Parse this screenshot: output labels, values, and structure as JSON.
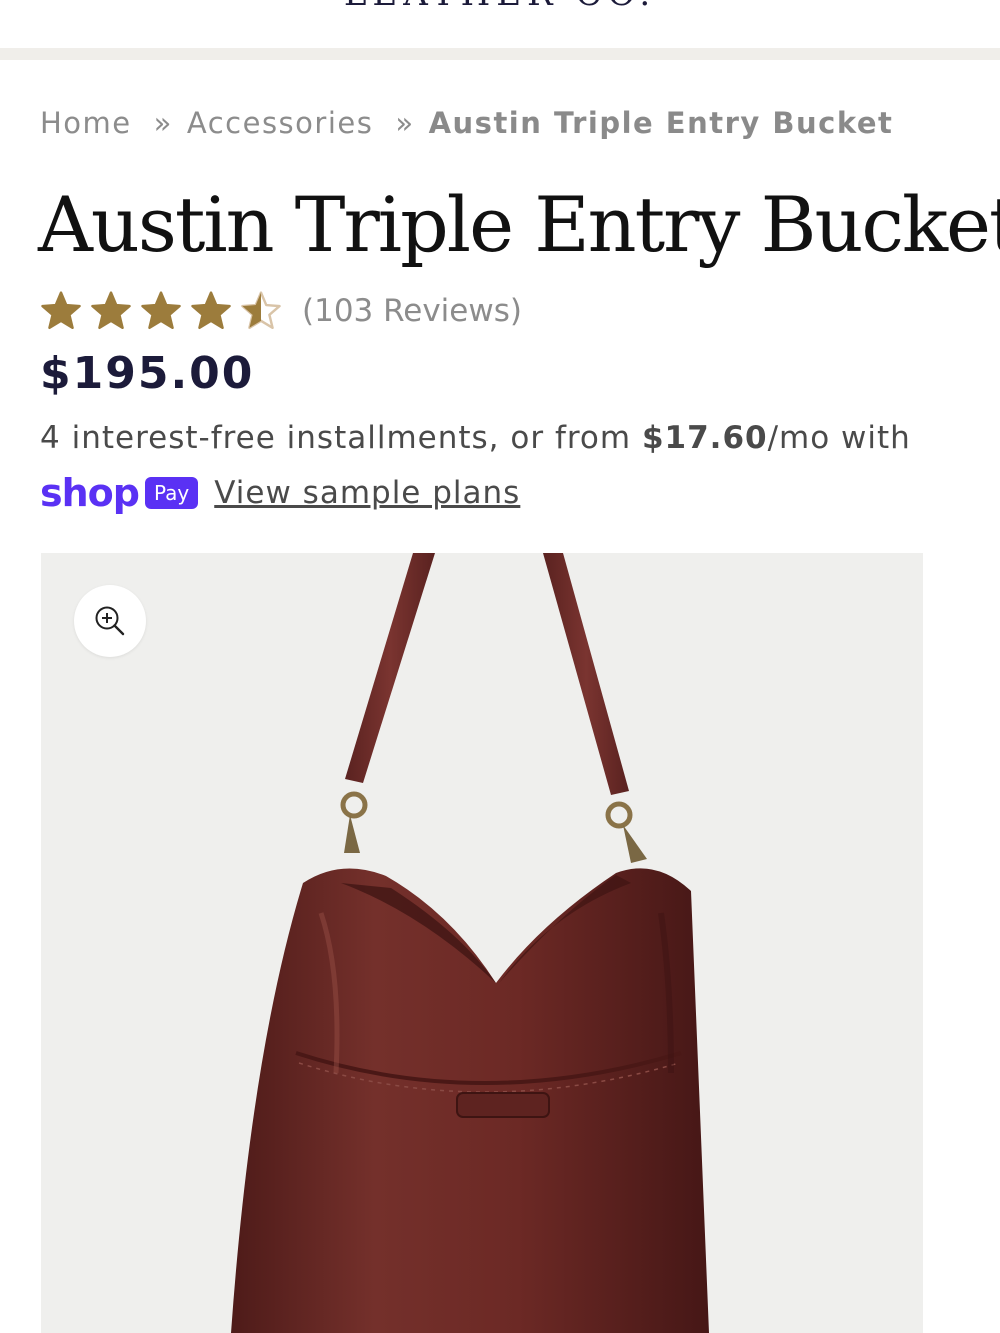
{
  "header": {
    "logo_text": "LEATHER CO."
  },
  "breadcrumb": {
    "items": [
      "Home",
      "Accessories"
    ],
    "separator": "»",
    "current": "Austin Triple Entry Bucket"
  },
  "product": {
    "title": "Austin Triple Entry Bucket",
    "rating": 4.5,
    "rating_max": 5,
    "reviews_text": "(103 Reviews)",
    "price": "$195.00"
  },
  "installments": {
    "text_before": "4 interest-free installments, or from ",
    "amount": "$17.60",
    "text_after": "/mo with",
    "shop_word": "shop",
    "pay_badge": "Pay",
    "link_text": "View sample plans"
  },
  "colors": {
    "star_gold": "#9c7c3c",
    "star_empty": "#d9c4a8",
    "shop_purple": "#5a31f4",
    "bag_leather": "#6e2a26",
    "price_navy": "#1c1b3a"
  },
  "icons": {
    "zoom": "zoom-in-icon",
    "star": "star-icon"
  }
}
